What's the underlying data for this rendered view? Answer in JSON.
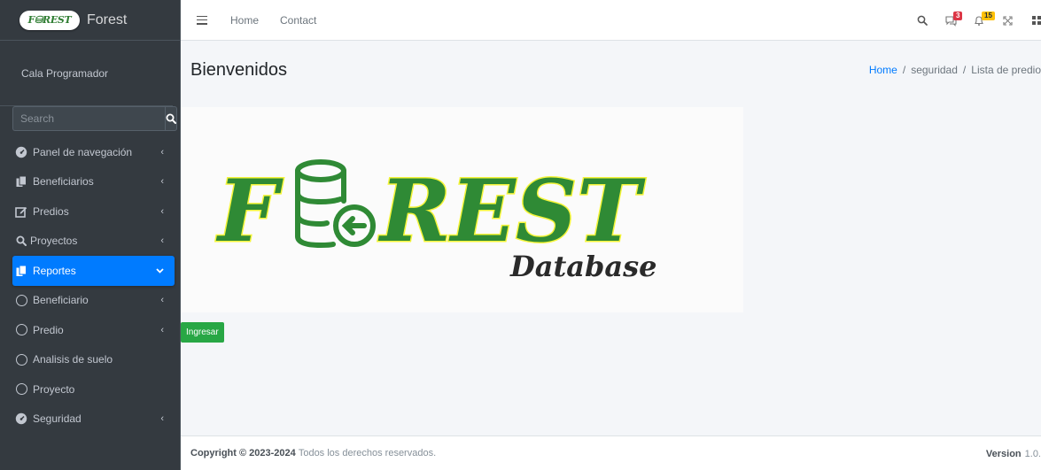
{
  "brand": {
    "logo_text": "F RES T",
    "title": "Forest"
  },
  "user": {
    "name": "Cala Programador"
  },
  "search": {
    "placeholder": "Search"
  },
  "sidebar": {
    "items": [
      {
        "label": "Panel de navegación",
        "icon": "tachometer-icon",
        "arrow": "‹"
      },
      {
        "label": "Beneficiarios",
        "icon": "copy-icon",
        "arrow": "‹"
      },
      {
        "label": "Predios",
        "icon": "edit-icon",
        "arrow": "‹"
      },
      {
        "label": "Proyectos",
        "icon": "search-icon",
        "arrow": "‹"
      },
      {
        "label": "Reportes",
        "icon": "copy-icon",
        "arrow": "⌄",
        "active": true
      },
      {
        "label": "Beneficiario",
        "icon": "circle-icon",
        "arrow": "‹"
      },
      {
        "label": "Predio",
        "icon": "circle-icon",
        "arrow": "‹"
      },
      {
        "label": "Analisis de suelo",
        "icon": "circle-icon",
        "arrow": ""
      },
      {
        "label": "Proyecto",
        "icon": "circle-icon",
        "arrow": ""
      },
      {
        "label": "Seguridad",
        "icon": "tachometer-icon",
        "arrow": "‹"
      }
    ]
  },
  "topnav": {
    "home": "Home",
    "contact": "Contact"
  },
  "badges": {
    "messages": "3",
    "notifications": "15"
  },
  "page": {
    "title": "Bienvenidos"
  },
  "breadcrumb": {
    "home": "Home",
    "section": "seguridad",
    "current": "Lista de predio"
  },
  "hero": {
    "word_left": "F",
    "word_right": "REST",
    "subtitle": "Database"
  },
  "actions": {
    "ingresar": "Ingresar"
  },
  "footer": {
    "copyright_bold": "Copyright © 2023-2024",
    "copyright_text": "Todos los derechos reservados.",
    "version_label": "Version",
    "version_value": "1.0."
  },
  "colors": {
    "sidebar": "#343a40",
    "active": "#007bff",
    "success": "#28a745",
    "logo_green": "#2f8a35"
  }
}
